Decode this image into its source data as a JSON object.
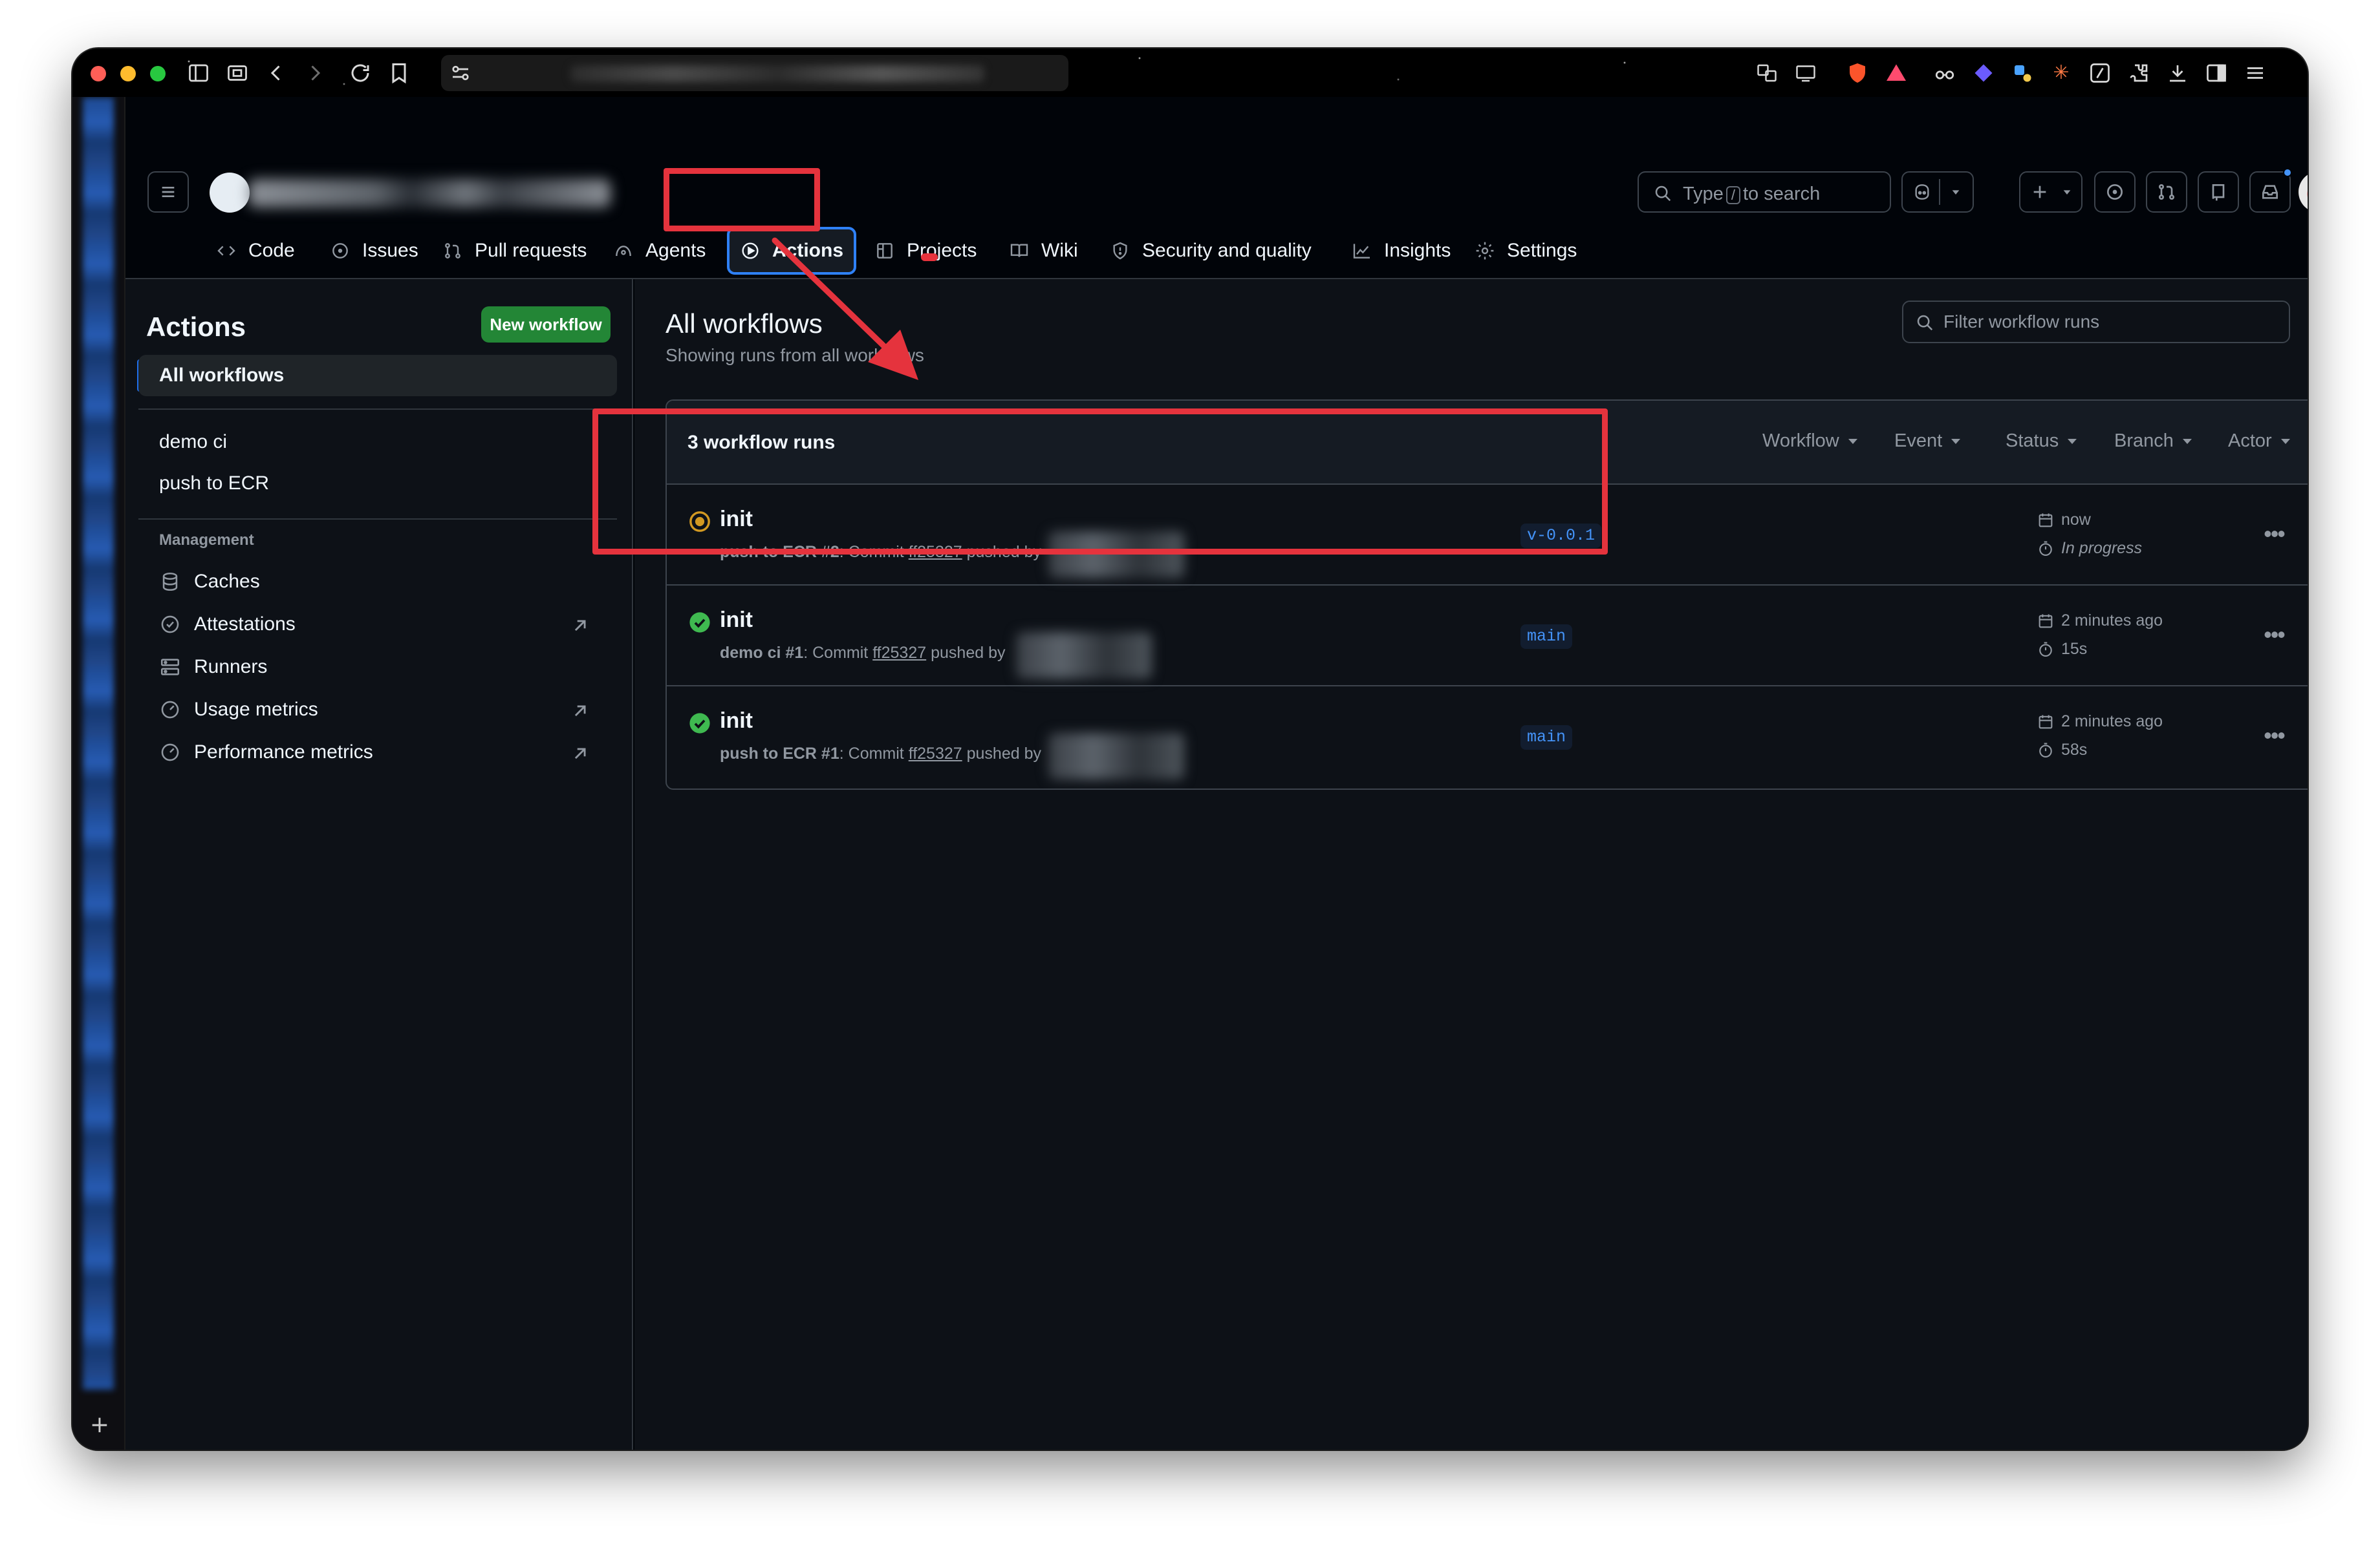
{
  "browser": {
    "icons": [
      "close-dot",
      "minimize-dot",
      "zoom-dot",
      "sidebar-icon",
      "tab-icon",
      "back-icon",
      "forward-icon",
      "reload-icon",
      "bookmark-icon",
      "site-settings-icon"
    ]
  },
  "header": {
    "search_prefix": "Type",
    "search_key": "/",
    "search_suffix": "to search"
  },
  "nav": {
    "items": [
      {
        "label": "Code",
        "icon": "code-icon"
      },
      {
        "label": "Issues",
        "icon": "issue-icon"
      },
      {
        "label": "Pull requests",
        "icon": "pull-request-icon"
      },
      {
        "label": "Agents",
        "icon": "agents-icon"
      },
      {
        "label": "Actions",
        "icon": "play-icon",
        "active": true
      },
      {
        "label": "Projects",
        "icon": "table-icon"
      },
      {
        "label": "Wiki",
        "icon": "book-icon"
      },
      {
        "label": "Security and quality",
        "icon": "shield-icon"
      },
      {
        "label": "Insights",
        "icon": "graph-icon"
      },
      {
        "label": "Settings",
        "icon": "gear-icon"
      }
    ]
  },
  "sidebar": {
    "title": "Actions",
    "new_workflow": "New workflow",
    "all_workflows": "All workflows",
    "workflows": [
      "demo ci",
      "push to ECR"
    ],
    "management_heading": "Management",
    "management": [
      {
        "label": "Caches",
        "icon": "database-icon",
        "external": false
      },
      {
        "label": "Attestations",
        "icon": "verified-icon",
        "external": true
      },
      {
        "label": "Runners",
        "icon": "server-icon",
        "external": false
      },
      {
        "label": "Usage metrics",
        "icon": "meter-icon",
        "external": true
      },
      {
        "label": "Performance metrics",
        "icon": "meter-icon",
        "external": true
      }
    ]
  },
  "main": {
    "title": "All workflows",
    "subtitle": "Showing runs from all workflows",
    "filter_placeholder": "Filter workflow runs",
    "runs_count": "3 workflow runs",
    "filters": [
      "Workflow",
      "Event",
      "Status",
      "Branch",
      "Actor"
    ],
    "runs": [
      {
        "status": "in-progress",
        "title": "init",
        "workflow": "push to ECR #2",
        "commit_prefix": ": Commit ",
        "commit": "ff25327",
        "pushed_by": " pushed by",
        "branch": "v-0.0.1",
        "time": "now",
        "duration": "In progress"
      },
      {
        "status": "success",
        "title": "init",
        "workflow": "demo ci #1",
        "commit_prefix": ": Commit ",
        "commit": "ff25327",
        "pushed_by": " pushed by",
        "branch": "main",
        "time": "2 minutes ago",
        "duration": "15s"
      },
      {
        "status": "success",
        "title": "init",
        "workflow": "push to ECR #1",
        "commit_prefix": ": Commit ",
        "commit": "ff25327",
        "pushed_by": " pushed by",
        "branch": "main",
        "time": "2 minutes ago",
        "duration": "58s"
      }
    ]
  },
  "colors": {
    "annotation": "#e5333d",
    "accent_blue": "#2f81f7",
    "success": "#3fb950",
    "in_progress": "#d29922",
    "primary_button": "#238636"
  }
}
